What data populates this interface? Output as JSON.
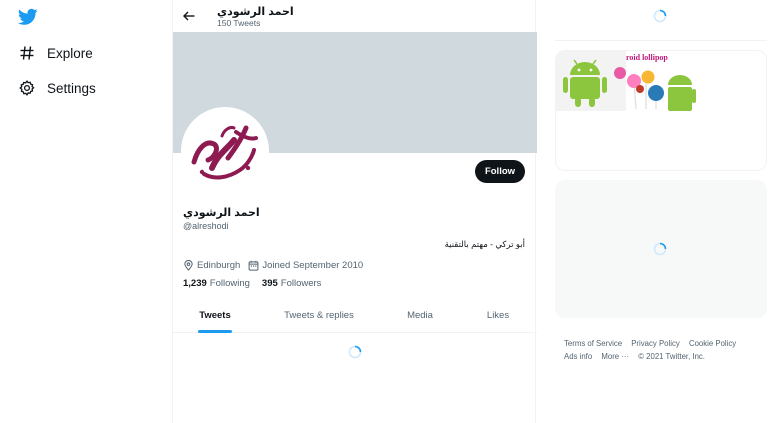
{
  "nav": {
    "logo": "twitter-bird",
    "items": [
      {
        "label": "Explore",
        "icon": "hashtag-icon"
      },
      {
        "label": "Settings",
        "icon": "gear-icon"
      }
    ]
  },
  "header": {
    "name": "احمد الرشودي",
    "tweet_count": "150 Tweets"
  },
  "profile": {
    "display_name": "احمد الرشودي",
    "handle": "@alreshodi",
    "bio": "أبو تركي - مهتم بالتقنية",
    "location": "Edinburgh",
    "joined": "Joined September 2010",
    "following_count": "1,239",
    "following_label": "Following",
    "followers_count": "395",
    "followers_label": "Followers",
    "follow_button": "Follow"
  },
  "tabs": [
    {
      "label": "Tweets",
      "active": true
    },
    {
      "label": "Tweets & replies",
      "active": false
    },
    {
      "label": "Media",
      "active": false
    },
    {
      "label": "Likes",
      "active": false
    }
  ],
  "sidebar": {
    "media_caption": "roid lollipop"
  },
  "footer": {
    "links": [
      "Terms of Service",
      "Privacy Policy",
      "Cookie Policy",
      "Ads info",
      "More ···"
    ],
    "copyright": "© 2021 Twitter, Inc."
  },
  "colors": {
    "accent": "#1d9bf0",
    "banner": "#cfd9de",
    "avatar_ink": "#8e1a52",
    "button_bg": "#0f1419"
  }
}
